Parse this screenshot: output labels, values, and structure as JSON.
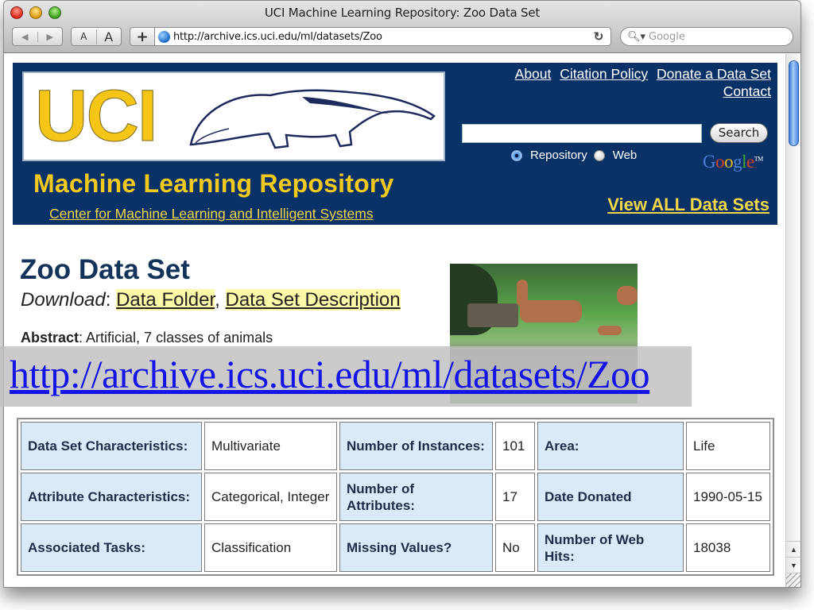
{
  "window": {
    "title": "UCI Machine Learning Repository: Zoo Data Set"
  },
  "toolbar": {
    "back_icon": "back-arrow-icon",
    "forward_icon": "forward-arrow-icon",
    "font_smaller_label": "A",
    "font_larger_label": "A",
    "add_bookmark_label": "+",
    "url": "http://archive.ics.uci.edu/ml/datasets/Zoo",
    "reload_icon": "reload-icon",
    "search_placeholder": "Google",
    "search_icon": "magnifier-icon"
  },
  "banner": {
    "logo_text": "UCI",
    "logo_mascot": "anteater",
    "subtitle": "Machine Learning Repository",
    "center_link": "Center for Machine Learning and Intelligent Systems",
    "links": [
      {
        "label": "About"
      },
      {
        "label": "Citation Policy"
      },
      {
        "label": "Donate a Data Set"
      },
      {
        "label": "Contact"
      }
    ],
    "search": {
      "value": "",
      "button_label": "Search",
      "options": [
        {
          "label": "Repository",
          "selected": true
        },
        {
          "label": "Web",
          "selected": false
        }
      ],
      "provider": "Google",
      "provider_tm": "TM"
    },
    "view_all_label": "View ALL Data Sets"
  },
  "dataset": {
    "title": "Zoo Data Set",
    "download_label": "Download",
    "download_links": [
      {
        "label": "Data Folder"
      },
      {
        "label": "Data Set Description"
      }
    ],
    "abstract_label": "Abstract",
    "abstract_text": "Artificial, 7 classes of animals",
    "photo_alt": "deer in a zoo enclosure"
  },
  "overlay_url": "http://archive.ics.uci.edu/ml/datasets/Zoo",
  "details_table": {
    "rows": [
      [
        {
          "label": "Data Set Characteristics:",
          "value": "Multivariate"
        },
        {
          "label": "Number of Instances:",
          "value": "101"
        },
        {
          "label": "Area:",
          "value": "Life"
        }
      ],
      [
        {
          "label": "Attribute Characteristics:",
          "value": "Categorical, Integer"
        },
        {
          "label": "Number of Attributes:",
          "value": "17"
        },
        {
          "label": "Date Donated",
          "value": "1990-05-15"
        }
      ],
      [
        {
          "label": "Associated Tasks:",
          "value": "Classification"
        },
        {
          "label": "Missing Values?",
          "value": "No"
        },
        {
          "label": "Number of Web Hits:",
          "value": "18038"
        }
      ]
    ]
  },
  "colors": {
    "banner_bg": "#0b3266",
    "logo_yellow": "#f5c518",
    "label_cell_bg": "#dbeaf9",
    "link_highlight": "#fdf9a8",
    "overlay_link": "#1414e6"
  }
}
